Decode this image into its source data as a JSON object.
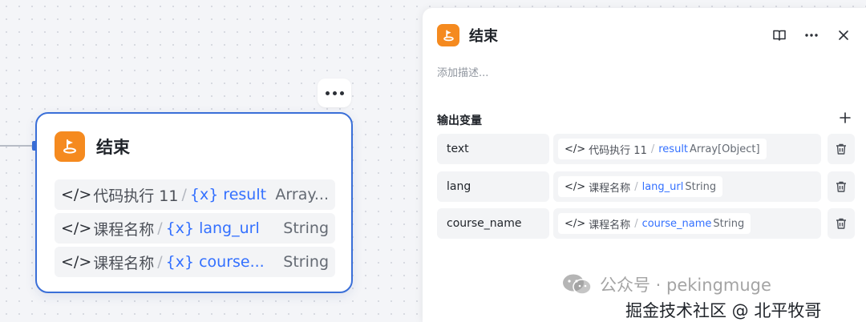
{
  "node": {
    "title": "结束",
    "more_label": "更多",
    "rows": [
      {
        "source": "代码执行 11",
        "separator": "/",
        "var_prefix": "{x}",
        "var_name": "result",
        "type": "Array..."
      },
      {
        "source": "课程名称",
        "separator": "/",
        "var_prefix": "{x}",
        "var_name": "lang_url",
        "type": "String"
      },
      {
        "source": "课程名称",
        "separator": "/",
        "var_prefix": "{x}",
        "var_name": "course...",
        "type": "String"
      }
    ]
  },
  "panel": {
    "title": "结束",
    "description_placeholder": "添加描述...",
    "section_title": "输出变量",
    "outputs": [
      {
        "name": "text",
        "source": "代码执行 11",
        "separator": "/",
        "var_name": "result",
        "type": "Array[Object]"
      },
      {
        "name": "lang",
        "source": "课程名称",
        "separator": "/",
        "var_name": "lang_url",
        "type": "String"
      },
      {
        "name": "course_name",
        "source": "课程名称",
        "separator": "/",
        "var_name": "course_name",
        "type": "String"
      }
    ]
  },
  "watermark": {
    "line1": "公众号 · pekingmuge",
    "line2": "掘金技术社区 @ 北平牧哥"
  },
  "colors": {
    "accent": "#3a6fd8",
    "link": "#3370ff",
    "icon_bg": "#f58a1f"
  },
  "icons": {
    "node_icon": "end-flag-icon",
    "code": "code-icon",
    "book": "book-icon",
    "more": "more-icon",
    "close": "close-icon",
    "plus": "plus-icon",
    "trash": "trash-icon",
    "wechat": "wechat-icon"
  }
}
